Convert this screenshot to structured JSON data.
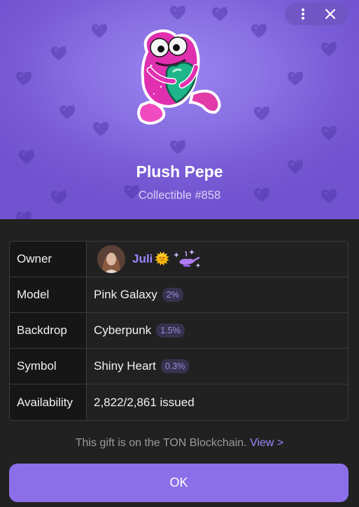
{
  "header": {
    "title": "Plush Pepe",
    "subtitle": "Collectible #858",
    "pattern_icon": "heart-icon",
    "background_accent": "#8a72e4"
  },
  "controls": {
    "more_icon": "more-vertical-icon",
    "close_icon": "close-icon"
  },
  "attributes": [
    {
      "key": "Owner"
    },
    {
      "key": "Model",
      "value": "Pink Galaxy",
      "badge": "2%"
    },
    {
      "key": "Backdrop",
      "value": "Cyberpunk",
      "badge": "1.5%"
    },
    {
      "key": "Symbol",
      "value": "Shiny Heart",
      "badge": "0.3%"
    },
    {
      "key": "Availability",
      "value": "2,822/2,861 issued"
    }
  ],
  "owner": {
    "name": "Juli",
    "emoji": "🌞",
    "status_icon": "magic-lamp-icon"
  },
  "footer": {
    "note": "This gift is on the TON Blockchain.",
    "link": "View >",
    "ok_label": "OK"
  },
  "colors": {
    "accent": "#8b6fe8",
    "link": "#9b86ff",
    "badge_bg": "#37324d",
    "background": "#212121"
  }
}
